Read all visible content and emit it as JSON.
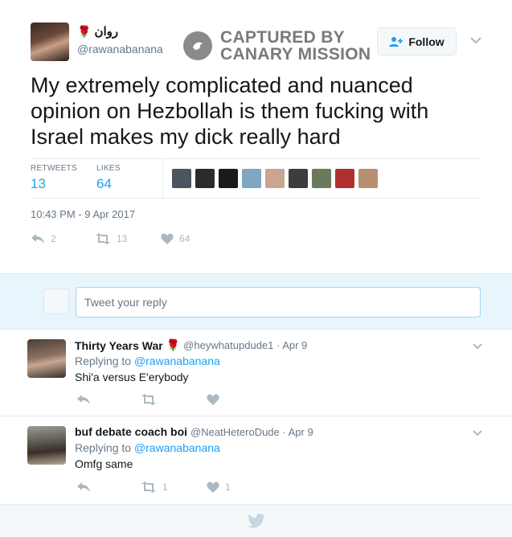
{
  "tweet": {
    "display_name": "روان",
    "handle": "@rawanabanana",
    "follow_label": "Follow",
    "text": "My extremely complicated and nuanced opinion on Hezbollah is them fucking with Israel makes my dick really hard",
    "retweets_label": "RETWEETS",
    "retweets_count": "13",
    "likes_label": "LIKES",
    "likes_count": "64",
    "timestamp": "10:43 PM - 9 Apr 2017",
    "actions": {
      "replies": "2",
      "retweets": "13",
      "likes": "64"
    },
    "liker_colors": [
      "#4a5560",
      "#2b2b2b",
      "#1a1a1a",
      "#7fa7c4",
      "#c8a690",
      "#3d3d3d",
      "#6b7a5a",
      "#b03030",
      "#b98f72"
    ]
  },
  "watermark": {
    "line1": "CAPTURED BY",
    "line2": "CANARY MISSION"
  },
  "reply_box": {
    "placeholder": "Tweet your reply"
  },
  "replies": [
    {
      "name": "Thirty Years War",
      "handle_time": "@heywhatupdude1 · Apr 9",
      "replying_prefix": "Replying to ",
      "replying_to": "@rawanabanana",
      "text": "Shi'a versus E'erybody",
      "retweets": "",
      "likes": ""
    },
    {
      "name": "buf debate coach boi",
      "handle_time": "@NeatHeteroDude · Apr 9",
      "replying_prefix": "Replying to ",
      "replying_to": "@rawanabanana",
      "text": "Omfg same",
      "retweets": "1",
      "likes": "1"
    }
  ],
  "colors": {
    "accent": "#1da1f2",
    "muted": "#657786",
    "icon": "#aab8c2",
    "rose": "#c0152a"
  }
}
